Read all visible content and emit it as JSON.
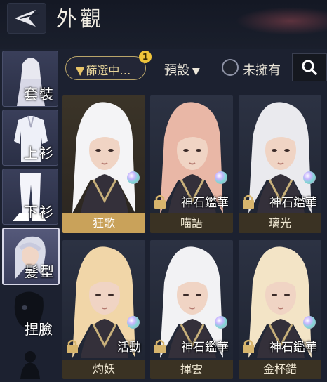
{
  "header": {
    "title": "外觀"
  },
  "sidebar": {
    "tabs": [
      {
        "label": "套裝",
        "active": false
      },
      {
        "label": "上衫",
        "active": false
      },
      {
        "label": "下衫",
        "active": false
      },
      {
        "label": "髮型",
        "active": true
      },
      {
        "label": "捏臉",
        "active": false
      }
    ]
  },
  "toolbar": {
    "filter_label": "篩選中…",
    "filter_count": "1",
    "preset_label": "預設",
    "unowned_label": "未擁有"
  },
  "cards": [
    {
      "name": "狂歌",
      "tag": "",
      "selected": true,
      "locked": false,
      "hair": "#f4f4f6"
    },
    {
      "name": "喵語",
      "tag": "神石鑑華",
      "selected": false,
      "locked": true,
      "hair": "#e9b7a6"
    },
    {
      "name": "璃光",
      "tag": "神石鑑華",
      "selected": false,
      "locked": true,
      "hair": "#eaeaee"
    },
    {
      "name": "灼妖",
      "tag": "活動",
      "selected": false,
      "locked": true,
      "hair": "#f1d6a8"
    },
    {
      "name": "揮雲",
      "tag": "神石鑑華",
      "selected": false,
      "locked": true,
      "hair": "#f2f2f4"
    },
    {
      "name": "金杯錯",
      "tag": "神石鑑華",
      "selected": false,
      "locked": true,
      "hair": "#f3e4c6"
    }
  ],
  "colors": {
    "accent": "#c9a25a",
    "badge": "#f0c43a",
    "bg": "#1c2130"
  }
}
